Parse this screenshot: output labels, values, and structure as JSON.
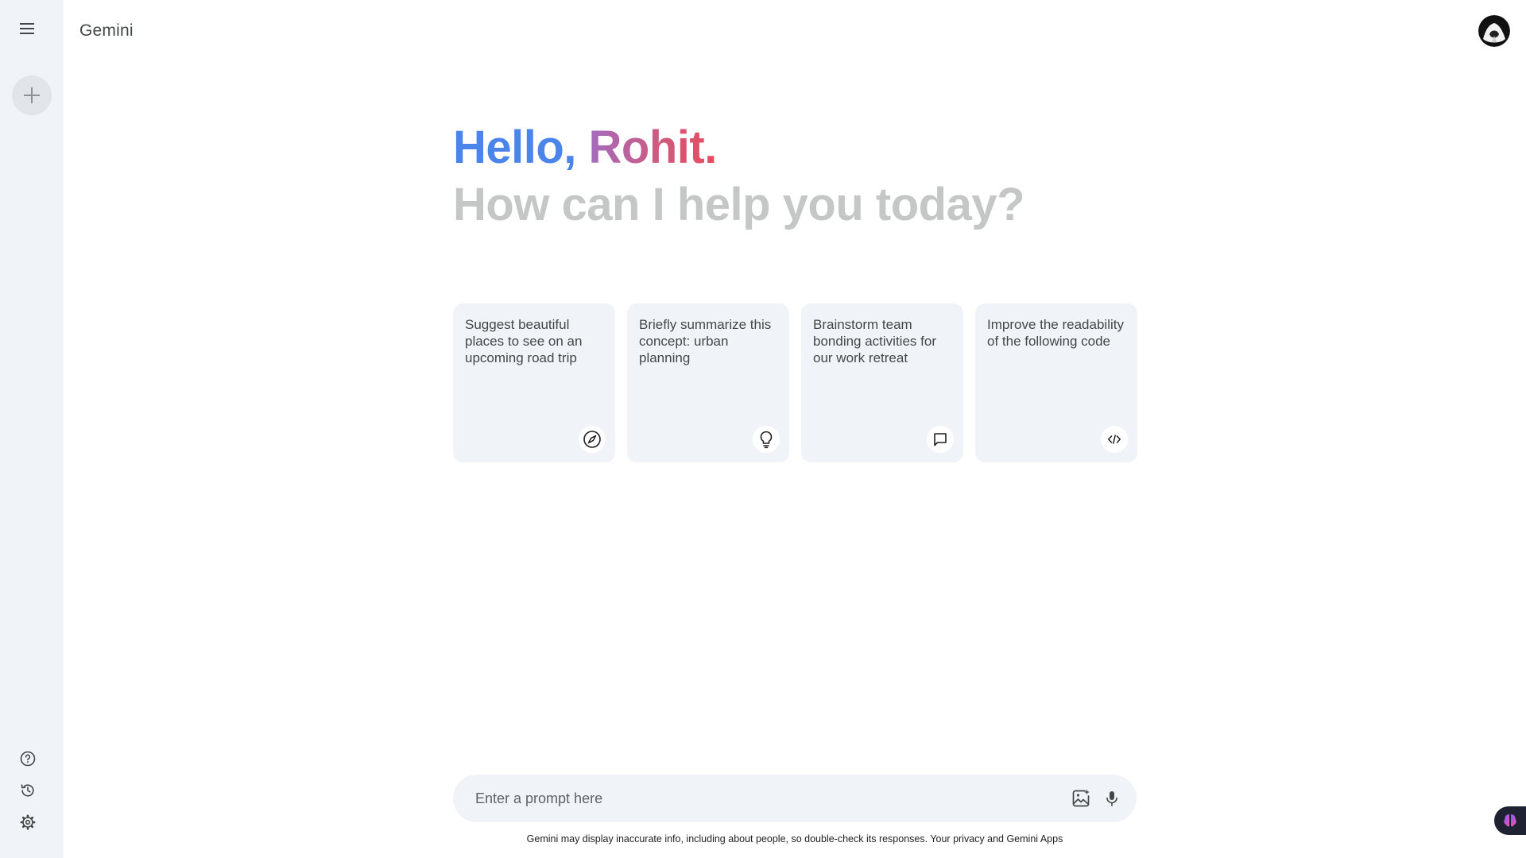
{
  "app": {
    "title": "Gemini"
  },
  "sidebar": {
    "menu_icon": "hamburger-menu-icon",
    "new_chat_icon": "plus-icon",
    "bottom_items": [
      {
        "icon": "help-circle-icon"
      },
      {
        "icon": "history-icon"
      },
      {
        "icon": "settings-gear-icon"
      }
    ]
  },
  "greeting": {
    "hello": "Hello,",
    "name": "Rohit.",
    "subtitle": "How can I help you today?"
  },
  "suggestions": [
    {
      "text": "Suggest beautiful places to see on an upcoming road trip",
      "icon": "compass-icon"
    },
    {
      "text": "Briefly summarize this concept: urban planning",
      "icon": "lightbulb-icon"
    },
    {
      "text": "Brainstorm team bonding activities for our work retreat",
      "icon": "chat-bubble-icon"
    },
    {
      "text": "Improve the readability of the following code",
      "icon": "code-icon"
    }
  ],
  "prompt": {
    "placeholder": "Enter a prompt here",
    "value": "",
    "image_icon": "add-image-icon",
    "mic_icon": "microphone-icon"
  },
  "disclaimer": "Gemini may display inaccurate info, including about people, so double-check its responses. Your privacy and Gemini Apps",
  "colors": {
    "sidebar_bg": "#f0f4f9",
    "card_bg": "#f0f4f9",
    "hello_blue": "#4b84ea",
    "name_gradient_start": "#a56bbf",
    "name_gradient_end": "#e94b5d",
    "subtitle_gray": "#c4c7c5"
  }
}
